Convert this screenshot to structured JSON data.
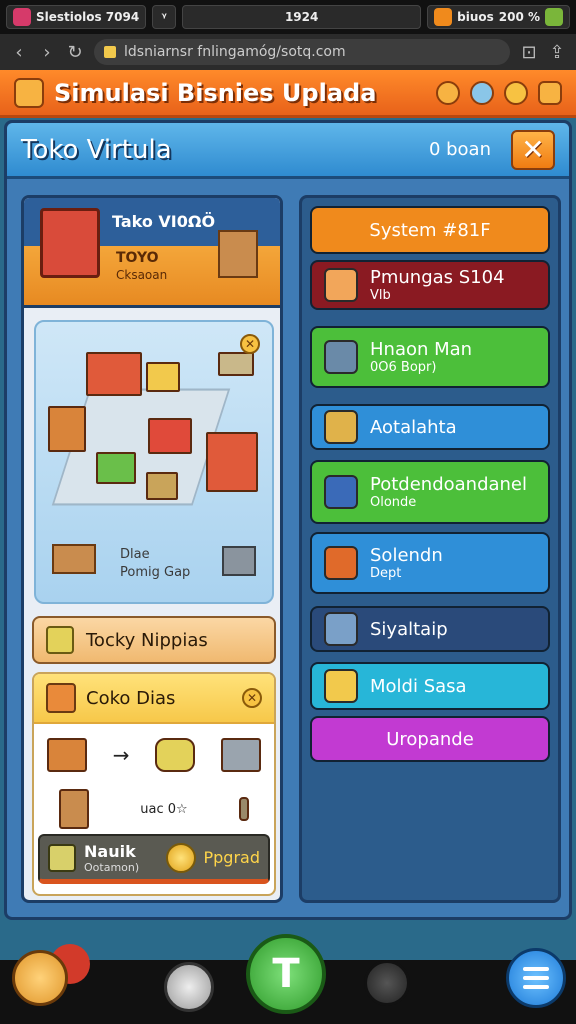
{
  "status_bar": {
    "app": "Slestiolos 7094",
    "center": "1924",
    "right_label": "biuos",
    "right_value": "200 %"
  },
  "browser": {
    "url": "ldsniarnsr fnlingamóg/sotq.com"
  },
  "header": {
    "title": "Simulasi Bisnies Uplada"
  },
  "window": {
    "title": "Toko Virtula",
    "subtitle": "0 boan",
    "close_label": "✕"
  },
  "shop": {
    "name": "Tako VI0ΩÖ",
    "tag": "TOYO",
    "sub": "Cksaoan"
  },
  "iso_panel": {
    "label_line1": "Dlae",
    "label_line2": "Pomig Gap",
    "close_label": "✕"
  },
  "upgrade_button": {
    "label": "Tocky Nippias"
  },
  "production": {
    "title": "Coko Dias",
    "close_label": "✕",
    "arrow": "→",
    "mid_text": "uac 0☆",
    "buy_title": "Nauik",
    "buy_sub": "Ootamon)",
    "buy_label": "Ppgrad"
  },
  "right_menu": [
    {
      "label": "System #81F",
      "sub": "",
      "color": "#f08a1c"
    },
    {
      "label": "Pmungas S104",
      "sub": "Vlb",
      "color": "#8a1a22"
    },
    {
      "label": "Hnaon Man",
      "sub": "0O6 Bopr)",
      "color": "#4cbf3a"
    },
    {
      "label": "Aotalahta",
      "sub": "",
      "color": "#2f8fd8"
    },
    {
      "label": "Potdendoandanel",
      "sub": "Olonde",
      "color": "#4cbf3a"
    },
    {
      "label": "Solendn",
      "sub": "Dept",
      "color": "#2f8fd8"
    },
    {
      "label": "Siyaltaip",
      "sub": "",
      "color": "#2a4a7a"
    },
    {
      "label": "Moldi Sasa",
      "sub": "",
      "color": "#27b6d8"
    },
    {
      "label": "Uropande",
      "sub": "",
      "color": "#c23ad2"
    }
  ],
  "bottom_bar": {
    "build_glyph": "T"
  }
}
